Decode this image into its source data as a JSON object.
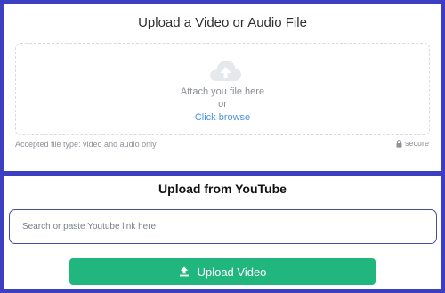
{
  "file_upload": {
    "title": "Upload a Video or Audio File",
    "icon": "cloud-upload-icon",
    "attach_text": "Attach you file here",
    "or_text": "or",
    "browse_label": "Click browse",
    "accepted_note": "Accepted file type: video and audio only",
    "secure_label": "secure"
  },
  "youtube": {
    "title": "Upload from YouTube",
    "placeholder": "Search or paste Youtube link here",
    "value": "",
    "button_label": "Upload Video",
    "button_icon": "upload-arrow-icon"
  },
  "colors": {
    "frame": "#3d3fc2",
    "button": "#22b67f",
    "link": "#4a90e2",
    "input_border": "#4b4d9c"
  }
}
